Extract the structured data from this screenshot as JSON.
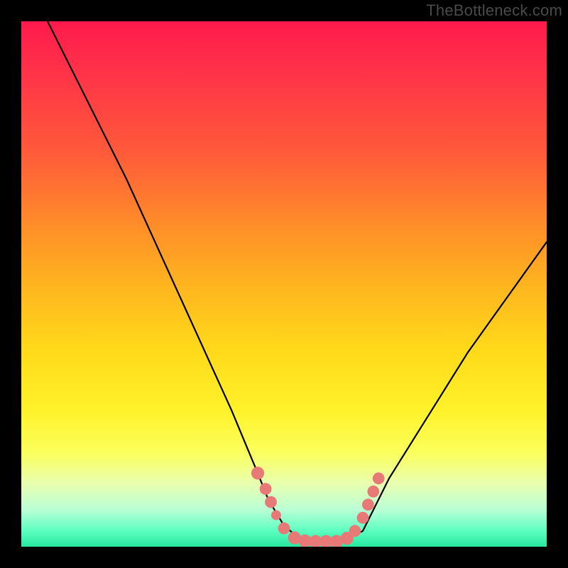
{
  "watermark": "TheBottleneck.com",
  "chart_data": {
    "type": "line",
    "title": "",
    "xlabel": "",
    "ylabel": "",
    "xlim": [
      0,
      100
    ],
    "ylim": [
      0,
      100
    ],
    "series": [
      {
        "name": "bottleneck-curve",
        "x": [
          5,
          10,
          15,
          20,
          25,
          30,
          35,
          40,
          45,
          47,
          50,
          53,
          55,
          57,
          60,
          62,
          65,
          67,
          70,
          75,
          80,
          85,
          90,
          95,
          100
        ],
        "y": [
          100,
          90,
          80,
          70,
          59,
          48,
          37,
          26,
          14,
          9,
          4,
          1.5,
          1,
          1,
          1,
          1.5,
          3,
          7,
          13,
          21,
          29,
          37,
          44,
          51,
          58
        ]
      }
    ],
    "markers": {
      "name": "highlight-dots",
      "color": "#e77a77",
      "points": [
        {
          "x": 45,
          "y": 14,
          "r": 1.3
        },
        {
          "x": 46.5,
          "y": 11,
          "r": 1.2
        },
        {
          "x": 47.5,
          "y": 8.5,
          "r": 1.2
        },
        {
          "x": 48.5,
          "y": 6,
          "r": 1.0
        },
        {
          "x": 50,
          "y": 3.5,
          "r": 1.2
        },
        {
          "x": 52,
          "y": 1.7,
          "r": 1.3
        },
        {
          "x": 54,
          "y": 1.1,
          "r": 1.3
        },
        {
          "x": 56,
          "y": 1.0,
          "r": 1.3
        },
        {
          "x": 58,
          "y": 1.0,
          "r": 1.3
        },
        {
          "x": 60,
          "y": 1.0,
          "r": 1.3
        },
        {
          "x": 62,
          "y": 1.6,
          "r": 1.3
        },
        {
          "x": 63.5,
          "y": 3.0,
          "r": 1.2
        },
        {
          "x": 65,
          "y": 5.5,
          "r": 1.2
        },
        {
          "x": 66,
          "y": 8.0,
          "r": 1.2
        },
        {
          "x": 67,
          "y": 10.5,
          "r": 1.2
        },
        {
          "x": 68,
          "y": 13,
          "r": 1.2
        }
      ]
    }
  }
}
